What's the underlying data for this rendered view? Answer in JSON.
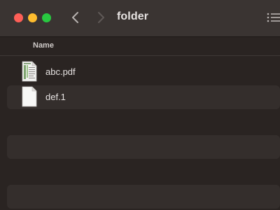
{
  "window": {
    "title": "folder"
  },
  "toolbar": {
    "back_icon": "chevron-left-icon",
    "forward_icon": "chevron-right-icon",
    "view_icon": "list-view-icon"
  },
  "columns": {
    "name": "Name"
  },
  "files": [
    {
      "name": "abc.pdf",
      "icon": "pdf-document-icon"
    },
    {
      "name": "def.1",
      "icon": "blank-document-icon"
    }
  ],
  "colors": {
    "close": "#fe5f57",
    "minimize": "#febc2e",
    "zoom": "#28c840",
    "background": "#2a2422",
    "titlebar": "#3a3432",
    "text": "#e7e3e2"
  }
}
